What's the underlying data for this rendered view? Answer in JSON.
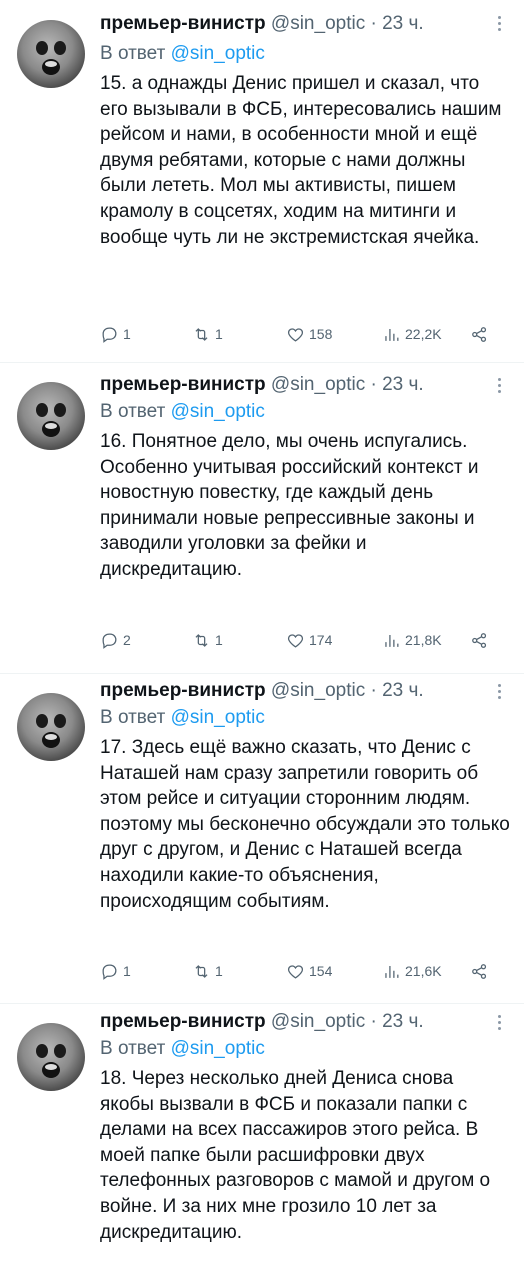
{
  "tweets": [
    {
      "name": "премьер-винистр",
      "handle": "@sin_optic",
      "dot": "·",
      "time": "23 ч.",
      "reply_prefix": "В ответ",
      "reply_handle": "@sin_optic",
      "text": "15. а однажды Денис пришел и сказал, что его вызывали в ФСБ, интересовались нашим рейсом и нами, в особенности мной и ещё двумя ребятами, которые с нами должны были лететь. Мол мы активисты, пишем крамолу в соцсетях, ходим на митинги и вообще чуть ли не экстремистская ячейка.",
      "replies": "1",
      "retweets": "1",
      "likes": "158",
      "views": "22,2K"
    },
    {
      "name": "премьер-винистр",
      "handle": "@sin_optic",
      "dot": "·",
      "time": "23 ч.",
      "reply_prefix": "В ответ",
      "reply_handle": "@sin_optic",
      "text": "16. Понятное дело, мы очень испугались. Особенно учитывая российский контекст и новостную повестку, где каждый день принимали новые репрессивные законы и заводили уголовки за фейки и дискредитацию.",
      "replies": "2",
      "retweets": "1",
      "likes": "174",
      "views": "21,8K"
    },
    {
      "name": "премьер-винистр",
      "handle": "@sin_optic",
      "dot": "·",
      "time": "23 ч.",
      "reply_prefix": "В ответ",
      "reply_handle": "@sin_optic",
      "text": "17. Здесь ещё важно сказать, что Денис с Наташей нам сразу запретили говорить об этом рейсе и ситуации сторонним людям. поэтому мы бесконечно обсуждали это только друг с другом, и Денис с Наташей всегда находили какие-то объяснения, происходящим событиям.",
      "replies": "1",
      "retweets": "1",
      "likes": "154",
      "views": "21,6K"
    },
    {
      "name": "премьер-винистр",
      "handle": "@sin_optic",
      "dot": "·",
      "time": "23 ч.",
      "reply_prefix": "В ответ",
      "reply_handle": "@sin_optic",
      "text": "18. Через несколько дней Дениса снова якобы вызвали в ФСБ и показали папки с делами на всех пассажиров этого рейса. В моей папке были расшифровки двух телефонных разговоров с мамой и другом о войне. И за них мне грозило 10 лет за дискредитацию."
    }
  ],
  "icons": {
    "reply": "reply-icon",
    "retweet": "retweet-icon",
    "like": "heart-icon",
    "views": "views-icon",
    "share": "share-icon",
    "more": "more-icon"
  },
  "colors": {
    "link": "#1d9bf0",
    "meta": "#536471",
    "text": "#0f1419"
  }
}
